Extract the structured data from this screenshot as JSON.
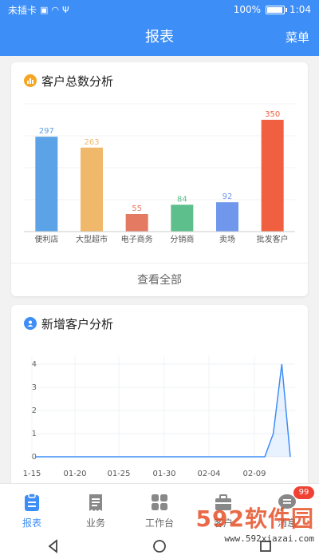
{
  "status_bar": {
    "carrier": "未插卡",
    "battery_text": "100%",
    "battery_level": 1.0,
    "time": "1:04"
  },
  "nav": {
    "title": "报表",
    "menu_label": "菜单"
  },
  "customer_total": {
    "title": "客户总数分析",
    "view_all": "查看全部",
    "accent_color": "#f5a623"
  },
  "new_customers": {
    "title": "新增客户分析",
    "accent_color": "#3e8ef7"
  },
  "chart_data": [
    {
      "type": "bar",
      "title": "客户总数分析",
      "categories": [
        "便利店",
        "大型超市",
        "电子商务",
        "分销商",
        "卖场",
        "批发客户"
      ],
      "values": [
        297,
        263,
        55,
        84,
        92,
        350
      ],
      "colors": [
        "#5ba3e6",
        "#f0b86a",
        "#e57a63",
        "#5cbf8c",
        "#6f97ec",
        "#f05f3f"
      ],
      "ylim": [
        0,
        400
      ],
      "grid": true
    },
    {
      "type": "area",
      "title": "新增客户分析",
      "x_tick_labels": [
        "1-15",
        "01-20",
        "01-25",
        "01-30",
        "02-04",
        "02-09"
      ],
      "y_ticks": [
        0,
        1,
        2,
        3,
        4
      ],
      "ylim": [
        0,
        4
      ],
      "series": [
        {
          "values": [
            0,
            0,
            0,
            0,
            0,
            0,
            0,
            0,
            0,
            0,
            0,
            0,
            0,
            0,
            0,
            0,
            0,
            0,
            0,
            0,
            0,
            0,
            0,
            0,
            0,
            0,
            0,
            0,
            1,
            4,
            0
          ]
        }
      ],
      "color": "#3e8ef7",
      "grid": true
    }
  ],
  "tab_bar": {
    "tabs": [
      {
        "label": "报表",
        "active": true
      },
      {
        "label": "业务",
        "active": false
      },
      {
        "label": "工作台",
        "active": false
      },
      {
        "label": "客户",
        "active": false
      },
      {
        "label": "消息",
        "badge": "99",
        "active": false
      }
    ]
  },
  "watermark": {
    "big": "592软件园",
    "small": "www.592xiazai.com"
  }
}
